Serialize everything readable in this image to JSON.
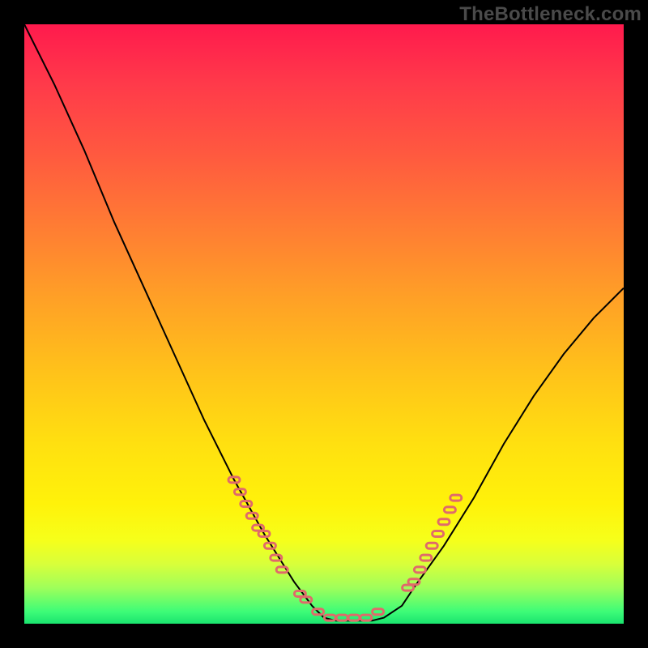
{
  "watermark": {
    "text": "TheBottleneck.com"
  },
  "colors": {
    "curve_stroke": "#000000",
    "marker_stroke": "#e06a6a",
    "marker_fill": "none"
  },
  "chart_data": {
    "type": "line",
    "title": "",
    "xlabel": "",
    "ylabel": "",
    "xlim": [
      0,
      100
    ],
    "ylim": [
      0,
      100
    ],
    "grid": false,
    "note": "V-shaped curve on vertical gradient. x in [0,100] left→right, y = bottleneck % (0 at bottom, 100 at top).",
    "series": [
      {
        "name": "bottleneck-curve",
        "x": [
          0,
          5,
          10,
          15,
          20,
          25,
          30,
          35,
          40,
          45,
          48,
          50,
          52,
          55,
          58,
          60,
          63,
          65,
          70,
          75,
          80,
          85,
          90,
          95,
          100
        ],
        "y": [
          100,
          90,
          79,
          67,
          56,
          45,
          34,
          24,
          15,
          7,
          3,
          1,
          0.5,
          0.5,
          0.5,
          1,
          3,
          6,
          13,
          21,
          30,
          38,
          45,
          51,
          56
        ]
      }
    ],
    "markers": {
      "name": "dashed-highlight-segments",
      "left": {
        "x": [
          35,
          36,
          37,
          38,
          39,
          40,
          41,
          42,
          43
        ],
        "y": [
          24,
          22,
          20,
          18,
          16,
          15,
          13,
          11,
          9
        ]
      },
      "bottom": {
        "x": [
          46,
          47,
          49,
          51,
          53,
          55,
          57,
          59
        ],
        "y": [
          5,
          4,
          2,
          1,
          1,
          1,
          1,
          2
        ]
      },
      "right": {
        "x": [
          64,
          65,
          66,
          67,
          68,
          69,
          70,
          71,
          72
        ],
        "y": [
          6,
          7,
          9,
          11,
          13,
          15,
          17,
          19,
          21
        ]
      }
    }
  }
}
